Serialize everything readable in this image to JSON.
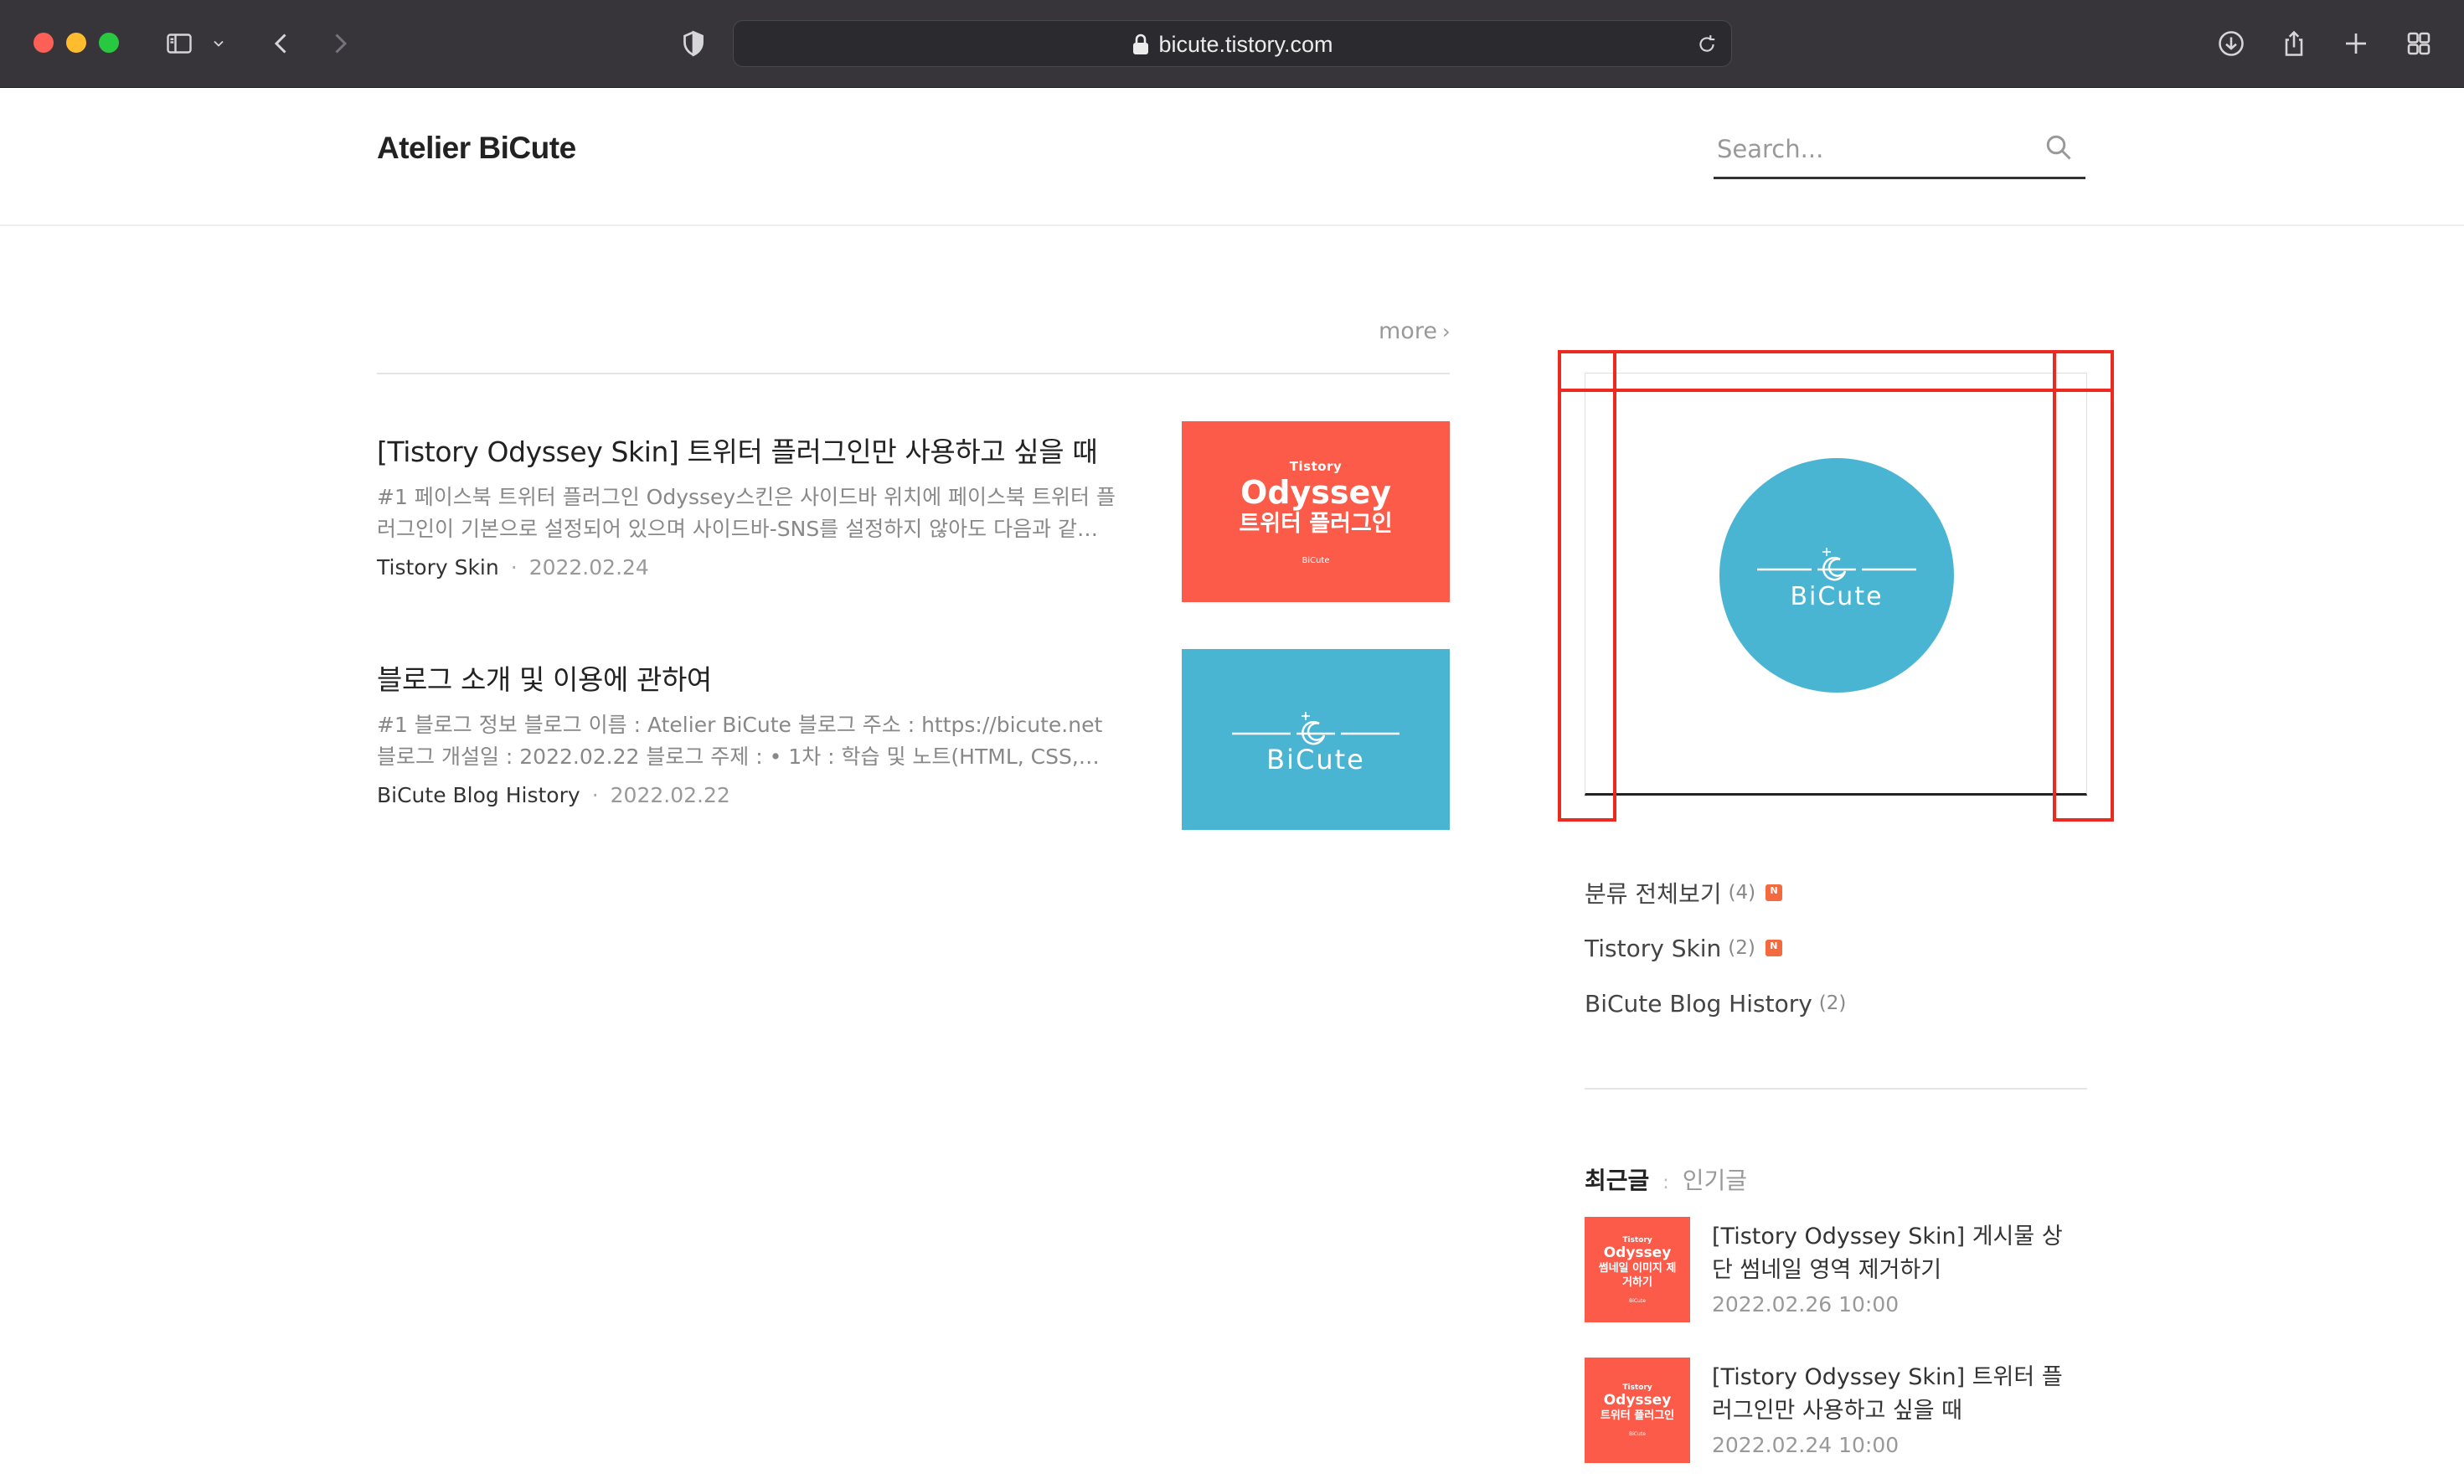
{
  "browser": {
    "url": "bicute.tistory.com"
  },
  "header": {
    "site_title": "Atelier BiCute",
    "search_placeholder": "Search..."
  },
  "main": {
    "more_label": "more",
    "posts": [
      {
        "title": "[Tistory Odyssey Skin] 트위터 플러그인만 사용하고 싶을 때",
        "excerpt": "#1 페이스북 트위터 플러그인 Odyssey스킨은 사이드바 위치에 페이스북 트위터 플러그인이 기본으로 설정되어 있으며 사이드바-SNS를 설정하지 않아도 다음과 같…",
        "category": "Tistory Skin",
        "date": "2022.02.24",
        "thumb": {
          "small": "Tistory",
          "big": "Odyssey",
          "kor": "트위터 플러그인",
          "brand": "BiCute"
        }
      },
      {
        "title": "블로그 소개 및 이용에 관하여",
        "excerpt": "#1 블로그 정보 블로그 이름 : Atelier BiCute 블로그 주소 : https://bicute.net 블로그 개설일 : 2022.02.22 블로그 주제 : • 1차 : 학습 및 노트(HTML, CSS,…",
        "category": "BiCute Blog History",
        "date": "2022.02.22",
        "thumb": {
          "logo_text": "BiCute"
        }
      }
    ]
  },
  "sidebar": {
    "profile_logo_text": "BiCute",
    "categories": [
      {
        "label": "분류 전체보기",
        "count": "(4)",
        "new": true
      },
      {
        "label": "Tistory Skin",
        "count": "(2)",
        "new": true
      },
      {
        "label": "BiCute Blog History",
        "count": "(2)",
        "new": false
      }
    ],
    "recent_tabs": {
      "active": "최근글",
      "inactive": "인기글"
    },
    "recent_posts": [
      {
        "title": "[Tistory Odyssey Skin] 게시물 상단 썸네일 영역 제거하기",
        "date": "2022.02.26 10:00",
        "thumb": {
          "s1": "Tistory",
          "s2": "Odyssey",
          "s3": "썸네일 이미지 제거하기",
          "s4": "BiCute"
        }
      },
      {
        "title": "[Tistory Odyssey Skin] 트위터 플러그인만 사용하고 싶을 때",
        "date": "2022.02.24 10:00",
        "thumb": {
          "s1": "Tistory",
          "s2": "Odyssey",
          "s3": "트위터 플러그인",
          "s4": "BiCute"
        }
      }
    ]
  },
  "colors": {
    "thumb_red": "#fb5b48",
    "thumb_blue": "#4ab5d3",
    "highlight_red": "#ec2a20",
    "new_badge": "#f26a3d"
  }
}
